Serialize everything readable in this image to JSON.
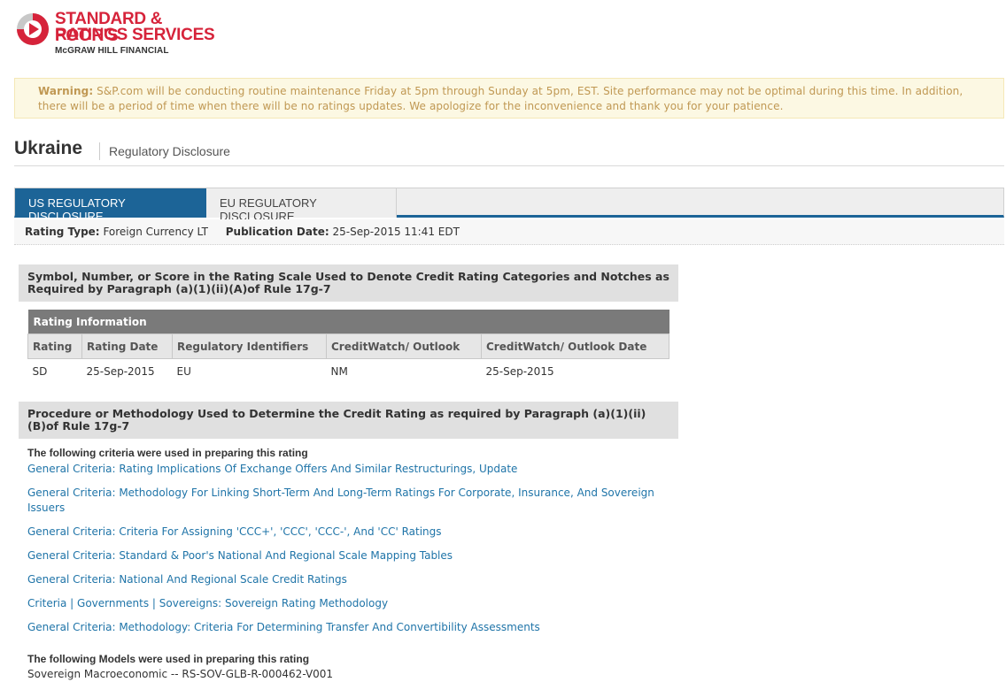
{
  "logo": {
    "line1": "STANDARD & POOR'S",
    "line2": "RATINGS SERVICES",
    "line3": "McGRAW HILL FINANCIAL"
  },
  "warning": {
    "label": "Warning:",
    "text": " S&P.com will be conducting routine maintenance Friday at 5pm through Sunday at 5pm, EST. Site performance may not be optimal during this time. In addition, there will be a period of time when there will be no ratings updates. We apologize for the inconvenience and thank you for your patience."
  },
  "header": {
    "country": "Ukraine",
    "subtitle": "Regulatory Disclosure"
  },
  "tabs": [
    {
      "label": "US REGULATORY DISCLOSURE",
      "active": true
    },
    {
      "label": "EU REGULATORY DISCLOSURE",
      "active": false
    }
  ],
  "info": {
    "rating_type_label": "Rating Type:",
    "rating_type_value": "Foreign Currency LT",
    "pub_date_label": "Publication Date:",
    "pub_date_value": "25-Sep-2015 11:41 EDT"
  },
  "section1": {
    "title": "Symbol, Number, or Score in the Rating Scale Used to Denote Credit Rating Categories and Notches as Required by Paragraph (a)(1)(ii)(A)of Rule 17g-7",
    "table_caption": "Rating Information",
    "columns": [
      "Rating",
      "Rating Date",
      "Regulatory Identifiers",
      "CreditWatch/ Outlook",
      "CreditWatch/ Outlook Date"
    ],
    "row": [
      "SD",
      "25-Sep-2015",
      "EU",
      "NM",
      "25-Sep-2015"
    ]
  },
  "section2": {
    "title": "Procedure or Methodology Used to Determine the Credit Rating as required by Paragraph (a)(1)(ii)(B)of Rule 17g-7",
    "criteria_heading": "The following criteria were used in preparing this rating",
    "criteria": [
      "General Criteria: Rating Implications Of Exchange Offers And Similar Restructurings, Update",
      "General Criteria: Methodology For Linking Short-Term And Long-Term Ratings For Corporate, Insurance, And Sovereign Issuers",
      "General Criteria: Criteria For Assigning 'CCC+', 'CCC', 'CCC-', And 'CC' Ratings",
      "General Criteria: Standard & Poor's National And Regional Scale Mapping Tables",
      "General Criteria: National And Regional Scale Credit Ratings",
      "Criteria | Governments | Sovereigns: Sovereign Rating Methodology",
      "General Criteria: Methodology: Criteria For Determining Transfer And Convertibility Assessments"
    ],
    "models_heading": "The following Models were used in preparing this rating",
    "model": "Sovereign Macroeconomic -- RS-SOV-GLB-R-000462-V001"
  }
}
